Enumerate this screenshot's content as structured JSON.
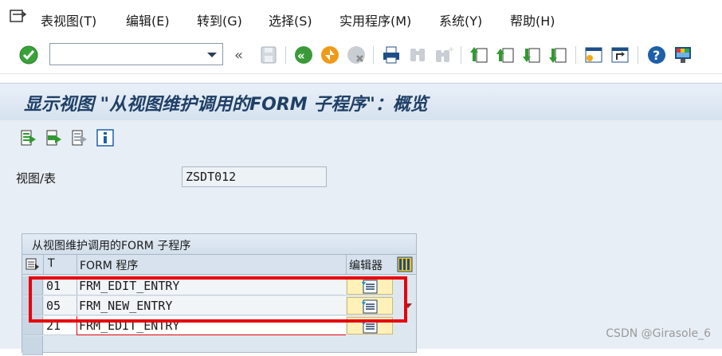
{
  "menubar": {
    "items": [
      {
        "label": "表视图(T)"
      },
      {
        "label": "编辑(E)"
      },
      {
        "label": "转到(G)"
      },
      {
        "label": "选择(S)"
      },
      {
        "label": "实用程序(M)"
      },
      {
        "label": "系统(Y)"
      },
      {
        "label": "帮助(H)"
      }
    ]
  },
  "toolbar": {
    "command_field_value": "",
    "icons": [
      "enter-icon",
      "command-dropdown-icon",
      "collapse-icon",
      "save-icon",
      "back-icon",
      "exit-icon",
      "cancel-icon",
      "print-icon",
      "find-icon",
      "find-next-icon",
      "first-page-icon",
      "previous-page-icon",
      "next-page-icon",
      "last-page-icon",
      "new-session-icon",
      "shortcut-icon",
      "help-icon",
      "layout-icon"
    ]
  },
  "title": "显示视图 \"从视图维护调用的FORM 子程序\"：概览",
  "app_toolbar": {
    "icons": [
      "select-all-icon",
      "select-block-icon",
      "deselect-all-icon",
      "information-icon"
    ]
  },
  "view": {
    "label": "视图/表",
    "value": "ZSDT012"
  },
  "table": {
    "title": "从视图维护调用的FORM 子程序",
    "headers": {
      "t": "T",
      "form": "FORM 程序",
      "editor": "编辑器"
    },
    "rows": [
      {
        "t": "01",
        "form": "FRM_EDIT_ENTRY"
      },
      {
        "t": "05",
        "form": "FRM_NEW_ENTRY"
      },
      {
        "t": "21",
        "form": "FRM_EDIT_ENTRY"
      }
    ]
  },
  "watermark": "CSDN @Girasole_6",
  "colors": {
    "title_text": "#1f3f66",
    "highlight_box": "#e8000b",
    "editor_cell": "#fff1b8",
    "enter_green": "#3aa23a"
  }
}
